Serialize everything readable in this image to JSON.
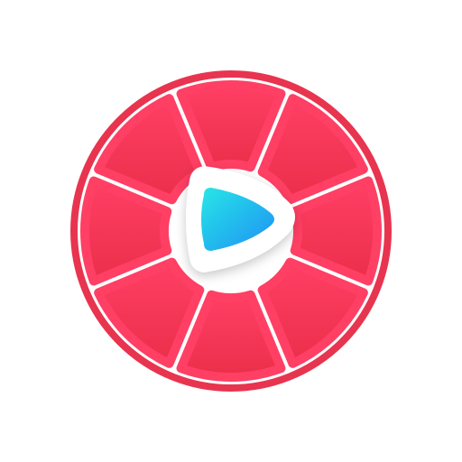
{
  "icon": {
    "name": "grapefruit-video-app-icon",
    "colors": {
      "background": "#ffffff",
      "ring": "#e8344f",
      "segment_top": "#ff3f64",
      "segment_bottom": "#ea2f4a",
      "divider": "#ffffff",
      "play_badge": "#ffffff",
      "play_gradient_start": "#28e6e6",
      "play_gradient_end": "#1d90f5"
    },
    "segment_count": 8,
    "glyph": "play-icon"
  }
}
